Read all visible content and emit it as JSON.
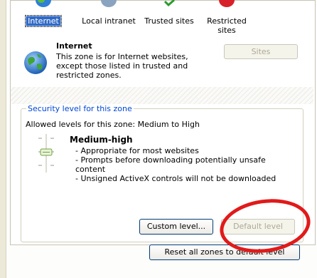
{
  "zones": [
    {
      "label": "Internet",
      "selected": true,
      "icon": "globe-icon"
    },
    {
      "label": "Local intranet",
      "selected": false,
      "icon": "intranet-icon"
    },
    {
      "label": "Trusted sites",
      "selected": false,
      "icon": "trusted-sites-icon"
    },
    {
      "label": "Restricted\nsites",
      "selected": false,
      "icon": "restricted-sites-icon"
    }
  ],
  "zone_info": {
    "title": "Internet",
    "description": "This zone is for Internet websites, except those listed in trusted and restricted zones.",
    "sites_button": "Sites"
  },
  "security": {
    "group_title": "Security level for this zone",
    "allowed_levels": "Allowed levels for this zone: Medium to High",
    "level_name": "Medium-high",
    "bullets": [
      "- Appropriate for most websites",
      "- Prompts before downloading potentially unsafe content",
      "- Unsigned ActiveX controls will not be downloaded"
    ],
    "custom_level_button": "Custom level...",
    "default_level_button": "Default level"
  },
  "reset_button": "Reset all zones to default level",
  "colors": {
    "selection": "#316ac5",
    "group_title": "#0046d5",
    "annotation": "#e11a1a"
  }
}
